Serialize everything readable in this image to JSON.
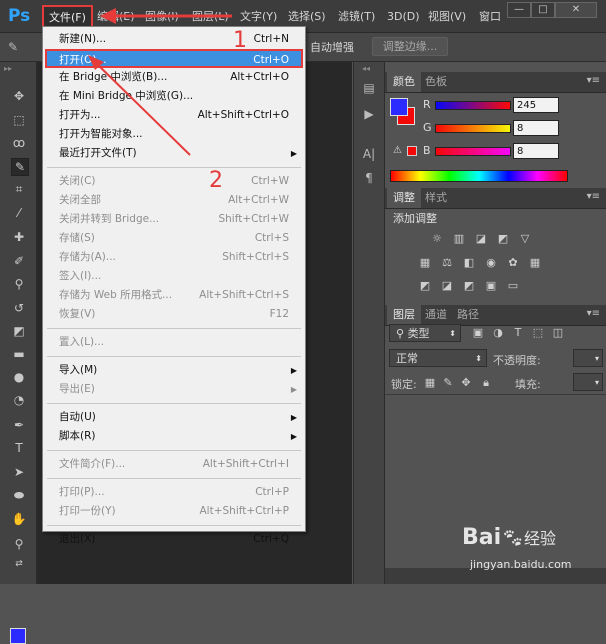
{
  "app": {
    "logo": "Ps"
  },
  "menubar": {
    "items": [
      "文件(F)",
      "编辑(E)",
      "图像(I)",
      "图层(L)",
      "文字(Y)",
      "选择(S)",
      "滤镜(T)",
      "3D(D)",
      "视图(V)",
      "窗口"
    ],
    "window_controls": [
      "—",
      "□",
      "✕"
    ]
  },
  "options_bar": {
    "auto_enhance": "自动增强",
    "refine_edge": "调整边缘..."
  },
  "file_menu": {
    "items": [
      {
        "label": "新建(N)...",
        "shortcut": "Ctrl+N",
        "disabled": false
      },
      {
        "label": "打开(O)...",
        "shortcut": "Ctrl+O",
        "disabled": false,
        "highlighted": true
      },
      {
        "label": "在 Bridge 中浏览(B)...",
        "shortcut": "Alt+Ctrl+O",
        "disabled": false
      },
      {
        "label": "在 Mini Bridge 中浏览(G)...",
        "shortcut": "",
        "disabled": false
      },
      {
        "label": "打开为...",
        "shortcut": "Alt+Shift+Ctrl+O",
        "disabled": false
      },
      {
        "label": "打开为智能对象...",
        "shortcut": "",
        "disabled": false
      },
      {
        "label": "最近打开文件(T)",
        "shortcut": "",
        "disabled": false,
        "submenu": true
      },
      {
        "separator": true
      },
      {
        "label": "关闭(C)",
        "shortcut": "Ctrl+W",
        "disabled": true
      },
      {
        "label": "关闭全部",
        "shortcut": "Alt+Ctrl+W",
        "disabled": true
      },
      {
        "label": "关闭并转到 Bridge...",
        "shortcut": "Shift+Ctrl+W",
        "disabled": true
      },
      {
        "label": "存储(S)",
        "shortcut": "Ctrl+S",
        "disabled": true
      },
      {
        "label": "存储为(A)...",
        "shortcut": "Shift+Ctrl+S",
        "disabled": true
      },
      {
        "label": "签入(I)...",
        "shortcut": "",
        "disabled": true
      },
      {
        "label": "存储为 Web 所用格式...",
        "shortcut": "Alt+Shift+Ctrl+S",
        "disabled": true
      },
      {
        "label": "恢复(V)",
        "shortcut": "F12",
        "disabled": true
      },
      {
        "separator": true
      },
      {
        "label": "置入(L)...",
        "shortcut": "",
        "disabled": true
      },
      {
        "separator": true
      },
      {
        "label": "导入(M)",
        "shortcut": "",
        "disabled": false,
        "submenu": true
      },
      {
        "label": "导出(E)",
        "shortcut": "",
        "disabled": true,
        "submenu": true
      },
      {
        "separator": true
      },
      {
        "label": "自动(U)",
        "shortcut": "",
        "disabled": false,
        "submenu": true
      },
      {
        "label": "脚本(R)",
        "shortcut": "",
        "disabled": false,
        "submenu": true
      },
      {
        "separator": true
      },
      {
        "label": "文件简介(F)...",
        "shortcut": "Alt+Shift+Ctrl+I",
        "disabled": true
      },
      {
        "separator": true
      },
      {
        "label": "打印(P)...",
        "shortcut": "Ctrl+P",
        "disabled": true
      },
      {
        "label": "打印一份(Y)",
        "shortcut": "Alt+Shift+Ctrl+P",
        "disabled": true
      },
      {
        "separator": true
      },
      {
        "label": "退出(X)",
        "shortcut": "Ctrl+Q",
        "disabled": false
      }
    ]
  },
  "color_panel": {
    "tabs": [
      "颜色",
      "色板"
    ],
    "channels": [
      {
        "label": "R",
        "value": "245"
      },
      {
        "label": "G",
        "value": "8"
      },
      {
        "label": "B",
        "value": "8"
      }
    ],
    "foreground_color": "#2b2bff",
    "background_color": "#f50808"
  },
  "adjust_panel": {
    "tabs": [
      "调整",
      "样式"
    ],
    "title": "添加调整"
  },
  "layers_panel": {
    "tabs": [
      "图层",
      "通道",
      "路径"
    ],
    "filter_kind": "类型",
    "blend_mode": "正常",
    "opacity_label": "不透明度:",
    "lock_label": "锁定:",
    "fill_label": "填充:"
  },
  "annotations": {
    "step1": "1",
    "step2": "2",
    "accent": "#e63b3b"
  },
  "watermark": {
    "brand": "Bai",
    "brand_tail": "经验",
    "url": "jingyan.baidu.com"
  }
}
